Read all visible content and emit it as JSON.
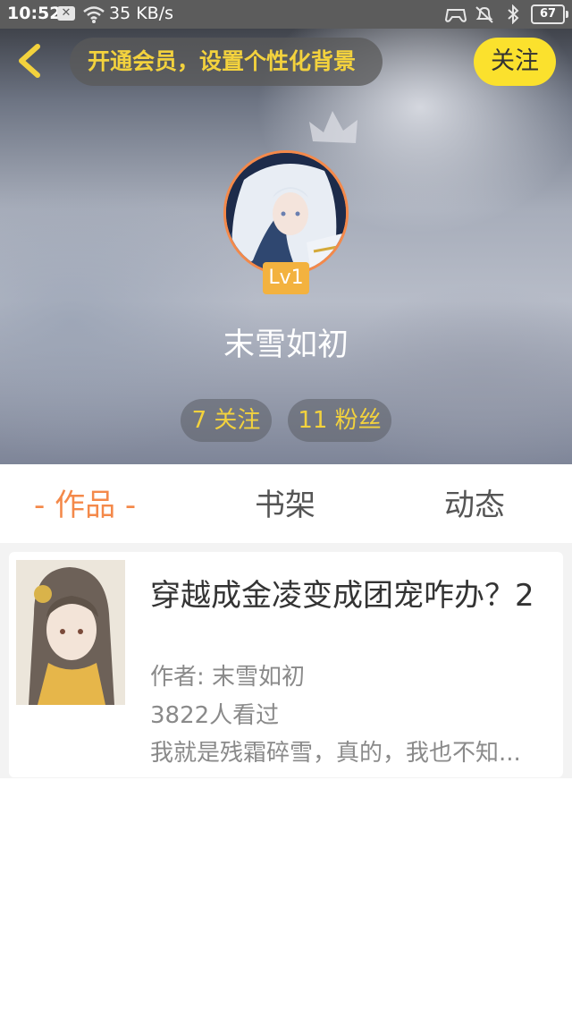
{
  "status_bar": {
    "time": "10:52",
    "notification_icon": "close-box-icon",
    "network_speed": "35 KB/s",
    "battery": "67",
    "icons": [
      "wifi-icon",
      "game-controller-icon",
      "mute-bell-icon",
      "bluetooth-icon",
      "battery-icon"
    ]
  },
  "header": {
    "back_icon": "chevron-left-icon",
    "vip_prompt": "开通会员，设置个性化背景",
    "follow_label": "关注"
  },
  "profile": {
    "level": "Lv1",
    "username": "末雪如初",
    "following": "7 关注",
    "fans": "11 粉丝"
  },
  "tabs": [
    {
      "label": "- 作品 -",
      "active": true
    },
    {
      "label": "书架",
      "active": false
    },
    {
      "label": "动态",
      "active": false
    }
  ],
  "works": [
    {
      "title": "穿越成金凌变成团宠咋办？2",
      "author": "作者: 末雪如初",
      "views": "3822人看过",
      "description": "我就是残霜碎雪，真的，我也不知..."
    }
  ],
  "colors": {
    "accent_orange": "#f4894a",
    "accent_yellow": "#fbe12d",
    "badge_orange": "#f3b23f",
    "vip_text": "#f3d23d"
  }
}
